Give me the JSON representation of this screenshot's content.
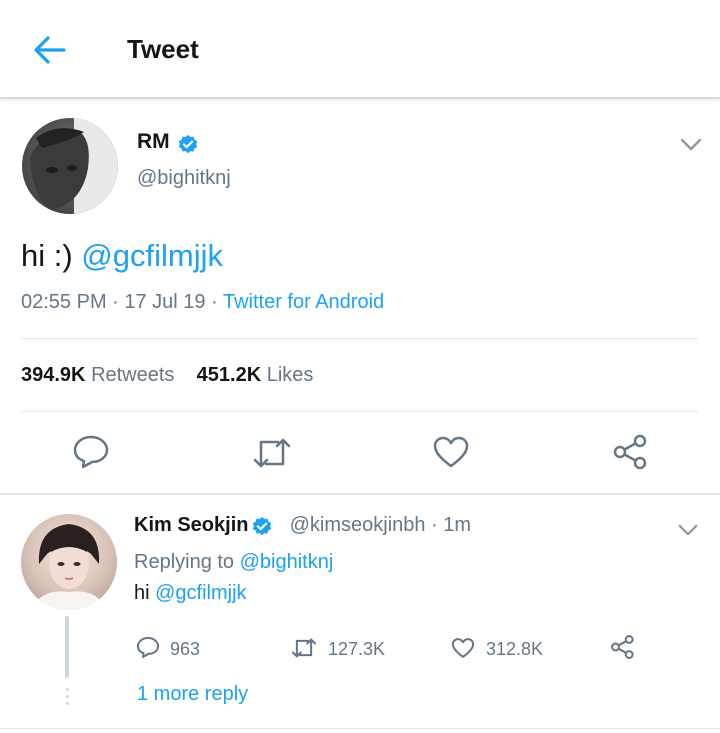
{
  "header": {
    "title": "Tweet",
    "back_icon": "arrow-left-icon"
  },
  "colors": {
    "accent": "#1da1f2",
    "text": "#14171a",
    "muted": "#657786",
    "divider": "#e1e8ed"
  },
  "tweet": {
    "author_name": "RM",
    "handle": "@bighitknj",
    "text_prefix": "hi :) ",
    "mention": "@gcfilmjjk",
    "time": "02:55 PM · 17 Jul 19 · ",
    "source": "Twitter for Android",
    "retweets_count": "394.9K",
    "retweets_label": "Retweets",
    "likes_count": "451.2K",
    "likes_label": "Likes"
  },
  "reply": {
    "author_name": "Kim Seokjin",
    "handle_time": "@kimseokjinbh · 1m",
    "replying_prefix": "Replying to ",
    "replying_handle": "@bighitknj",
    "text_prefix": "hi ",
    "mention": "@gcfilmjjk",
    "replies_count": "963",
    "retweets_count": "127.3K",
    "likes_count": "312.8K",
    "more_replies": "1 more reply"
  }
}
